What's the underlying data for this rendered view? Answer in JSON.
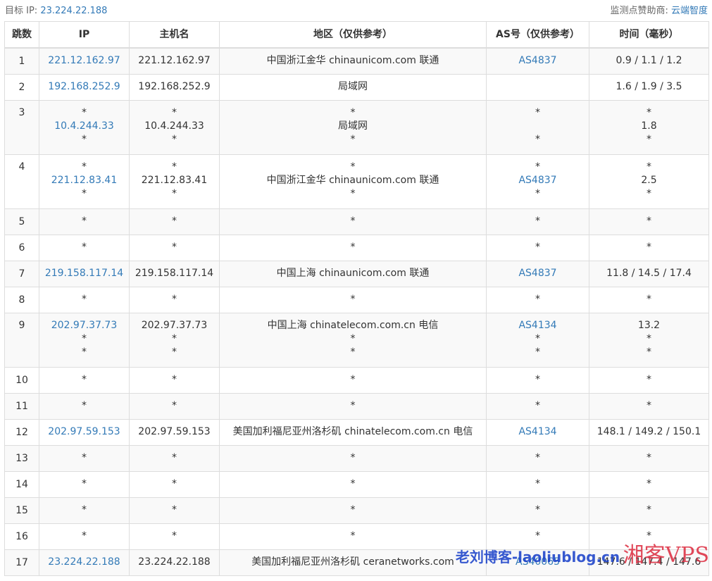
{
  "header": {
    "target_label": "目标 IP:",
    "target_ip": "23.224.22.188",
    "sponsor_label": "监测点赞助商:",
    "sponsor_name": "云端智度"
  },
  "columns": [
    "跳数",
    "IP",
    "主机名",
    "地区（仅供参考）",
    "AS号（仅供参考）",
    "时间（毫秒）"
  ],
  "rows": [
    {
      "hop": "1",
      "ip": [
        "221.12.162.97"
      ],
      "host": [
        "221.12.162.97"
      ],
      "region": [
        "中国浙江金华 chinaunicom.com 联通"
      ],
      "as": [
        "AS4837"
      ],
      "time": [
        "0.9 / 1.1 / 1.2"
      ]
    },
    {
      "hop": "2",
      "ip": [
        "192.168.252.9"
      ],
      "host": [
        "192.168.252.9"
      ],
      "region": [
        "局域网"
      ],
      "as": [
        ""
      ],
      "time": [
        "1.6 / 1.9 / 3.5"
      ]
    },
    {
      "hop": "3",
      "ip": [
        "*",
        "10.4.244.33",
        "*"
      ],
      "host": [
        "*",
        "10.4.244.33",
        "*"
      ],
      "region": [
        "*",
        "局域网",
        "*"
      ],
      "as": [
        "*",
        "",
        "*"
      ],
      "time": [
        "*",
        "1.8",
        "*"
      ]
    },
    {
      "hop": "4",
      "ip": [
        "*",
        "221.12.83.41",
        "*"
      ],
      "host": [
        "*",
        "221.12.83.41",
        "*"
      ],
      "region": [
        "*",
        "中国浙江金华 chinaunicom.com 联通",
        "*"
      ],
      "as": [
        "*",
        "AS4837",
        "*"
      ],
      "time": [
        "*",
        "2.5",
        "*"
      ]
    },
    {
      "hop": "5",
      "ip": [
        "*"
      ],
      "host": [
        "*"
      ],
      "region": [
        "*"
      ],
      "as": [
        "*"
      ],
      "time": [
        "*"
      ]
    },
    {
      "hop": "6",
      "ip": [
        "*"
      ],
      "host": [
        "*"
      ],
      "region": [
        "*"
      ],
      "as": [
        "*"
      ],
      "time": [
        "*"
      ]
    },
    {
      "hop": "7",
      "ip": [
        "219.158.117.14"
      ],
      "host": [
        "219.158.117.14"
      ],
      "region": [
        "中国上海 chinaunicom.com 联通"
      ],
      "as": [
        "AS4837"
      ],
      "time": [
        "11.8 / 14.5 / 17.4"
      ]
    },
    {
      "hop": "8",
      "ip": [
        "*"
      ],
      "host": [
        "*"
      ],
      "region": [
        "*"
      ],
      "as": [
        "*"
      ],
      "time": [
        "*"
      ]
    },
    {
      "hop": "9",
      "ip": [
        "202.97.37.73",
        "*",
        "*"
      ],
      "host": [
        "202.97.37.73",
        "*",
        "*"
      ],
      "region": [
        "中国上海 chinatelecom.com.cn 电信",
        "*",
        "*"
      ],
      "as": [
        "AS4134",
        "*",
        "*"
      ],
      "time": [
        "13.2",
        "*",
        "*"
      ]
    },
    {
      "hop": "10",
      "ip": [
        "*"
      ],
      "host": [
        "*"
      ],
      "region": [
        "*"
      ],
      "as": [
        "*"
      ],
      "time": [
        "*"
      ]
    },
    {
      "hop": "11",
      "ip": [
        "*"
      ],
      "host": [
        "*"
      ],
      "region": [
        "*"
      ],
      "as": [
        "*"
      ],
      "time": [
        "*"
      ]
    },
    {
      "hop": "12",
      "ip": [
        "202.97.59.153"
      ],
      "host": [
        "202.97.59.153"
      ],
      "region": [
        "美国加利福尼亚州洛杉矶 chinatelecom.com.cn 电信"
      ],
      "as": [
        "AS4134"
      ],
      "time": [
        "148.1 / 149.2 / 150.1"
      ]
    },
    {
      "hop": "13",
      "ip": [
        "*"
      ],
      "host": [
        "*"
      ],
      "region": [
        "*"
      ],
      "as": [
        "*"
      ],
      "time": [
        "*"
      ]
    },
    {
      "hop": "14",
      "ip": [
        "*"
      ],
      "host": [
        "*"
      ],
      "region": [
        "*"
      ],
      "as": [
        "*"
      ],
      "time": [
        "*"
      ]
    },
    {
      "hop": "15",
      "ip": [
        "*"
      ],
      "host": [
        "*"
      ],
      "region": [
        "*"
      ],
      "as": [
        "*"
      ],
      "time": [
        "*"
      ]
    },
    {
      "hop": "16",
      "ip": [
        "*"
      ],
      "host": [
        "*"
      ],
      "region": [
        "*"
      ],
      "as": [
        "*"
      ],
      "time": [
        "*"
      ]
    },
    {
      "hop": "17",
      "ip": [
        "23.224.22.188"
      ],
      "host": [
        "23.224.22.188"
      ],
      "region": [
        "美国加利福尼亚州洛杉矶 ceranetworks.com"
      ],
      "as": [
        "AS40065"
      ],
      "time": [
        "147.6 / 147.4 / 147.6"
      ]
    }
  ],
  "watermark": {
    "text_a": "老刘博客-laoliublog.cn",
    "text_b": "湘客VPS"
  },
  "colors": {
    "link": "#337ab7",
    "border": "#dddddd",
    "stripe": "#f9f9f9"
  }
}
